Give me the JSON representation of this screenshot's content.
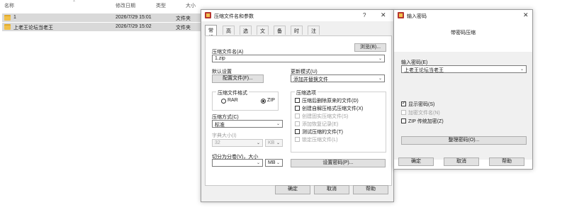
{
  "explorer": {
    "columns": {
      "name": "名称",
      "modified": "修改日期",
      "type": "类型",
      "size": "大小"
    },
    "rows": [
      {
        "name": "1",
        "modified": "2026/7/29 15:01",
        "type": "文件夹"
      },
      {
        "name": "上老王论坛当老王",
        "modified": "2026/7/29 15:02",
        "type": "文件夹"
      }
    ]
  },
  "archive_dialog": {
    "title": "压缩文件名和参数",
    "help_btn": "?",
    "close_btn": "✕",
    "tabs": [
      "常规",
      "高级",
      "选项",
      "文件",
      "备份",
      "时间",
      "注释"
    ],
    "archive_name_label": "压缩文件名(A)",
    "browse_btn": "浏览(B)...",
    "archive_name_value": "1.zip",
    "default_settings_label": "默认设置",
    "profiles_btn": "配置文件(F)...",
    "update_mode_label": "更新模式(U)",
    "update_mode_value": "添加并替换文件",
    "format_group_label": "压缩文件格式",
    "format_rar": "RAR",
    "format_zip": "ZIP",
    "method_label": "压缩方式(C)",
    "method_value": "标准",
    "dict_label": "字典大小(I)",
    "dict_value": "32",
    "dict_unit": "KB",
    "split_label": "切分为分卷(V)，大小",
    "split_value": "",
    "split_unit": "MB",
    "options_label": "压缩选项",
    "options": [
      {
        "label": "压缩后删除原来的文件(D)",
        "checked": false,
        "enabled": true
      },
      {
        "label": "创建自解压格式压缩文件(X)",
        "checked": false,
        "enabled": true
      },
      {
        "label": "创建固实压缩文件(S)",
        "checked": false,
        "enabled": false
      },
      {
        "label": "添加恢复记录(E)",
        "checked": false,
        "enabled": false
      },
      {
        "label": "测试压缩的文件(T)",
        "checked": false,
        "enabled": true
      },
      {
        "label": "锁定压缩文件(L)",
        "checked": false,
        "enabled": false
      }
    ],
    "set_password_btn": "设置密码(P)...",
    "ok_btn": "确定",
    "cancel_btn": "取消",
    "help_bottom_btn": "帮助"
  },
  "password_dialog": {
    "title": "输入密码",
    "close_btn": "✕",
    "heading": "带密码压缩",
    "password_label": "输入密码(E)",
    "password_value": "上老王论坛当老王",
    "show_password": "显示密码(S)",
    "encrypt_names": "加密文件名(N)",
    "zip_legacy": "ZIP 传统加密(Z)",
    "organize_btn": "整理密码(O)...",
    "ok_btn": "确定",
    "cancel_btn": "取消",
    "help_btn": "帮助"
  }
}
